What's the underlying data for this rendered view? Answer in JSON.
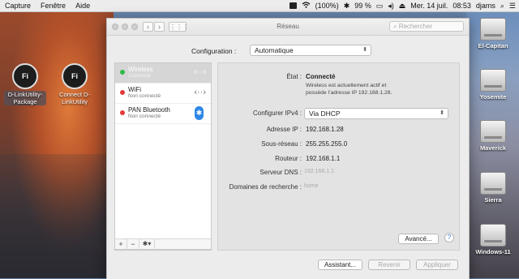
{
  "menubar": {
    "items": [
      "Capture",
      "Fenêtre",
      "Aide"
    ],
    "wifi_status": "(100%)",
    "battery": "99 %",
    "date": "Mer. 14 juil.",
    "time": "08:53",
    "user": "djams"
  },
  "desktop": {
    "left_icons": [
      {
        "label": "D-LinkUtility-Package",
        "badge": "Fi"
      },
      {
        "label": "Connect D-LinkUtility",
        "badge": "Fi"
      }
    ],
    "disks": [
      "El-Capitan",
      "Yosemite",
      "Maverick",
      "Sierra",
      "Windows-11"
    ]
  },
  "window": {
    "title": "Réseau",
    "search_placeholder": "Rechercher",
    "configuration_label": "Configuration :",
    "configuration_value": "Automatique",
    "services": [
      {
        "name": "Wireless",
        "status": "Connecté",
        "color": "#2fb84a",
        "selected": true
      },
      {
        "name": "WiFi",
        "status": "Non connecté",
        "color": "#e23b3b",
        "selected": false
      },
      {
        "name": "PAN Bluetooth",
        "status": "Non connecté",
        "color": "#e23b3b",
        "selected": false
      }
    ],
    "tools": [
      "+",
      "−",
      "✱▾"
    ],
    "detail": {
      "etat_label": "État :",
      "etat_value": "Connecté",
      "etat_desc_line1": "Wireless  est actuellement actif et",
      "etat_desc_line2": "possède l’adresse IP 192.168.1.28.",
      "ipv4_label": "Configurer IPv4 :",
      "ipv4_value": "Via DHCP",
      "ip_label": "Adresse IP :",
      "ip_value": "192.168.1.28",
      "mask_label": "Sous-réseau :",
      "mask_value": "255.255.255.0",
      "router_label": "Routeur :",
      "router_value": "192.168.1.1",
      "dns_label": "Serveur DNS :",
      "dns_value": "192.168.1.1",
      "search_domains_label": "Domaines de recherche :",
      "search_domains_value": "home",
      "advanced_button": "Avancé...",
      "help_button": "?"
    },
    "footer": {
      "assistant": "Assistant...",
      "revert": "Revenir",
      "apply": "Appliquer"
    }
  }
}
